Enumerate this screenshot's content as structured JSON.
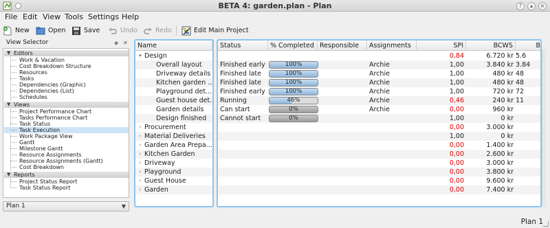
{
  "window": {
    "title": "BETA 4: garden.plan - Plan"
  },
  "menu": [
    "File",
    "Edit",
    "View",
    "Tools",
    "Settings",
    "Help"
  ],
  "toolbar": {
    "new": "New",
    "open": "Open",
    "save": "Save",
    "undo": "Undo",
    "redo": "Redo",
    "edit_main_project": "Edit Main Project"
  },
  "view_selector": {
    "title": "View Selector",
    "categories": [
      {
        "label": "Editors",
        "items": [
          "Work & Vacation",
          "Cost Breakdown Structure",
          "Resources",
          "Tasks",
          "Dependencies (Graphic)",
          "Dependencies (List)",
          "Schedules"
        ]
      },
      {
        "label": "Views",
        "items": [
          "Project Performance Chart",
          "Tasks Performance Chart",
          "Task Status",
          "Task Execution",
          "Work Package View",
          "Gantt",
          "Milestone Gantt",
          "Resource Assignments",
          "Resource Assignments (Gantt)",
          "Cost Breakdown"
        ]
      },
      {
        "label": "Reports",
        "items": [
          "Project Status Report",
          "Task Status Report"
        ]
      }
    ],
    "selected": "Task Execution",
    "plan_combo": "Plan 1"
  },
  "tree": {
    "header": "Name",
    "rows": [
      {
        "name": "Design",
        "level": 0,
        "expanded": true
      },
      {
        "name": "Overall layout",
        "level": 1
      },
      {
        "name": "Driveway details",
        "level": 1
      },
      {
        "name": "Kitchen garden ...",
        "level": 1
      },
      {
        "name": "Playground det...",
        "level": 1
      },
      {
        "name": "Guest house det...",
        "level": 1
      },
      {
        "name": "Garden details",
        "level": 1
      },
      {
        "name": "Design finished",
        "level": 1
      },
      {
        "name": "Procurement",
        "level": 0,
        "expanded": false
      },
      {
        "name": "Material Deliveries",
        "level": 0,
        "expanded": false
      },
      {
        "name": "Garden Area Prepa...",
        "level": 0,
        "expanded": false
      },
      {
        "name": "Kitchen Garden",
        "level": 0,
        "expanded": false
      },
      {
        "name": "Driveway",
        "level": 0,
        "expanded": false
      },
      {
        "name": "Playground",
        "level": 0,
        "expanded": false
      },
      {
        "name": "Guest House",
        "level": 0,
        "expanded": false
      },
      {
        "name": "Garden",
        "level": 0,
        "expanded": false
      }
    ]
  },
  "table": {
    "columns": [
      "Status",
      "% Completed",
      "Responsible",
      "Assignments",
      "SPI",
      "BCWS",
      "B"
    ],
    "rows": [
      {
        "status": "",
        "progress": null,
        "progress_label": "",
        "responsible": "",
        "assignments": "",
        "spi": "0,84",
        "spi_color": "red",
        "bcws": "6.720 kr",
        "b": "5.6"
      },
      {
        "status": "Finished early",
        "progress": 100,
        "progress_label": "100%",
        "responsible": "",
        "assignments": "Archie",
        "spi": "1,00",
        "spi_color": "black",
        "bcws": "3.840 kr",
        "b": "3.84"
      },
      {
        "status": "Finished late",
        "progress": 100,
        "progress_label": "100%",
        "responsible": "",
        "assignments": "Archie",
        "spi": "1,00",
        "spi_color": "black",
        "bcws": "480 kr",
        "b": "48"
      },
      {
        "status": "Finished late",
        "progress": 100,
        "progress_label": "100%",
        "responsible": "",
        "assignments": "Archie",
        "spi": "1,00",
        "spi_color": "black",
        "bcws": "480 kr",
        "b": "48"
      },
      {
        "status": "Finished early",
        "progress": 100,
        "progress_label": "100%",
        "responsible": "",
        "assignments": "Archie",
        "spi": "1,00",
        "spi_color": "black",
        "bcws": "720 kr",
        "b": "72"
      },
      {
        "status": "Running",
        "progress": 46,
        "progress_label": "46%",
        "responsible": "",
        "assignments": "Archie",
        "spi": "0,46",
        "spi_color": "red",
        "bcws": "240 kr",
        "b": "11"
      },
      {
        "status": "Can start",
        "progress": 0,
        "progress_label": "0%",
        "responsible": "",
        "assignments": "Archie",
        "spi": "0,00",
        "spi_color": "red",
        "bcws": "960 kr",
        "b": ""
      },
      {
        "status": "Cannot start",
        "progress": 0,
        "progress_label": "0%",
        "responsible": "",
        "assignments": "",
        "spi": "1,00",
        "spi_color": "black",
        "bcws": "0 kr",
        "b": ""
      },
      {
        "status": "",
        "progress": null,
        "progress_label": "",
        "responsible": "",
        "assignments": "",
        "spi": "0,00",
        "spi_color": "red",
        "bcws": "3.000 kr",
        "b": ""
      },
      {
        "status": "",
        "progress": null,
        "progress_label": "",
        "responsible": "",
        "assignments": "",
        "spi": "1,00",
        "spi_color": "black",
        "bcws": "0 kr",
        "b": ""
      },
      {
        "status": "",
        "progress": null,
        "progress_label": "",
        "responsible": "",
        "assignments": "",
        "spi": "0,00",
        "spi_color": "red",
        "bcws": "1.400 kr",
        "b": ""
      },
      {
        "status": "",
        "progress": null,
        "progress_label": "",
        "responsible": "",
        "assignments": "",
        "spi": "0,00",
        "spi_color": "red",
        "bcws": "2.600 kr",
        "b": ""
      },
      {
        "status": "",
        "progress": null,
        "progress_label": "",
        "responsible": "",
        "assignments": "",
        "spi": "0,00",
        "spi_color": "red",
        "bcws": "3.000 kr",
        "b": ""
      },
      {
        "status": "",
        "progress": null,
        "progress_label": "",
        "responsible": "",
        "assignments": "",
        "spi": "0,00",
        "spi_color": "red",
        "bcws": "3.800 kr",
        "b": ""
      },
      {
        "status": "",
        "progress": null,
        "progress_label": "",
        "responsible": "",
        "assignments": "",
        "spi": "0,00",
        "spi_color": "red",
        "bcws": "9.600 kr",
        "b": ""
      },
      {
        "status": "",
        "progress": null,
        "progress_label": "",
        "responsible": "",
        "assignments": "",
        "spi": "0,00",
        "spi_color": "red",
        "bcws": "7.400 kr",
        "b": ""
      }
    ]
  },
  "statusbar": {
    "text": "Plan 1"
  },
  "colors": {
    "accent": "#8cc4ee",
    "red": "#e00000",
    "selection": "#cfe3f6"
  }
}
